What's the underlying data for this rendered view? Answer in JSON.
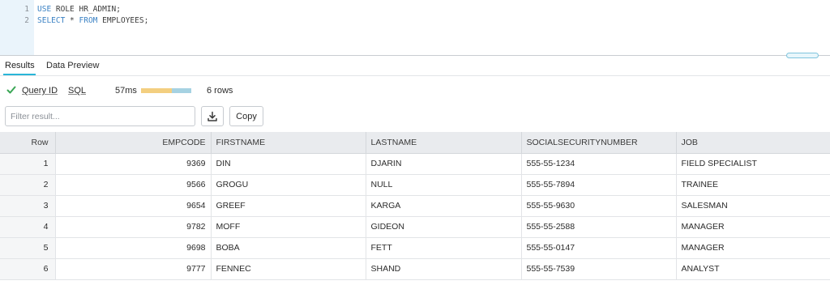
{
  "editor": {
    "lines": [
      {
        "number": "1",
        "keyword": "USE",
        "rest": " ROLE HR_ADMIN;"
      },
      {
        "number": "2",
        "keyword": "SELECT",
        "middle": " * ",
        "keyword2": "FROM",
        "rest": " EMPLOYEES;"
      }
    ]
  },
  "tabs": [
    {
      "label": "Results",
      "active": true
    },
    {
      "label": "Data Preview",
      "active": false
    }
  ],
  "status": {
    "icon": "check-icon",
    "query_id_label": "Query ID",
    "sql_label": "SQL",
    "duration": "57ms",
    "rows": "6 rows",
    "colors": {
      "success": "#3aa655",
      "compile": "#f3cf80",
      "execute": "#a6d2e2",
      "accent": "#29b5d8"
    }
  },
  "filter": {
    "placeholder": "Filter result...",
    "value": ""
  },
  "download_icon": "download-icon",
  "copy_label": "Copy",
  "table": {
    "columns": [
      "Row",
      "EMPCODE",
      "FIRSTNAME",
      "LASTNAME",
      "SOCIALSECURITYNUMBER",
      "JOB"
    ],
    "rows": [
      [
        "1",
        "9369",
        "DIN",
        "DJARIN",
        "555-55-1234",
        "FIELD SPECIALIST"
      ],
      [
        "2",
        "9566",
        "GROGU",
        "NULL",
        "555-55-7894",
        "TRAINEE"
      ],
      [
        "3",
        "9654",
        "GREEF",
        "KARGA",
        "555-55-9630",
        "SALESMAN"
      ],
      [
        "4",
        "9782",
        "MOFF",
        "GIDEON",
        "555-55-2588",
        "MANAGER"
      ],
      [
        "5",
        "9698",
        "BOBA",
        "FETT",
        "555-55-0147",
        "MANAGER"
      ],
      [
        "6",
        "9777",
        "FENNEC",
        "SHAND",
        "555-55-7539",
        "ANALYST"
      ]
    ]
  }
}
